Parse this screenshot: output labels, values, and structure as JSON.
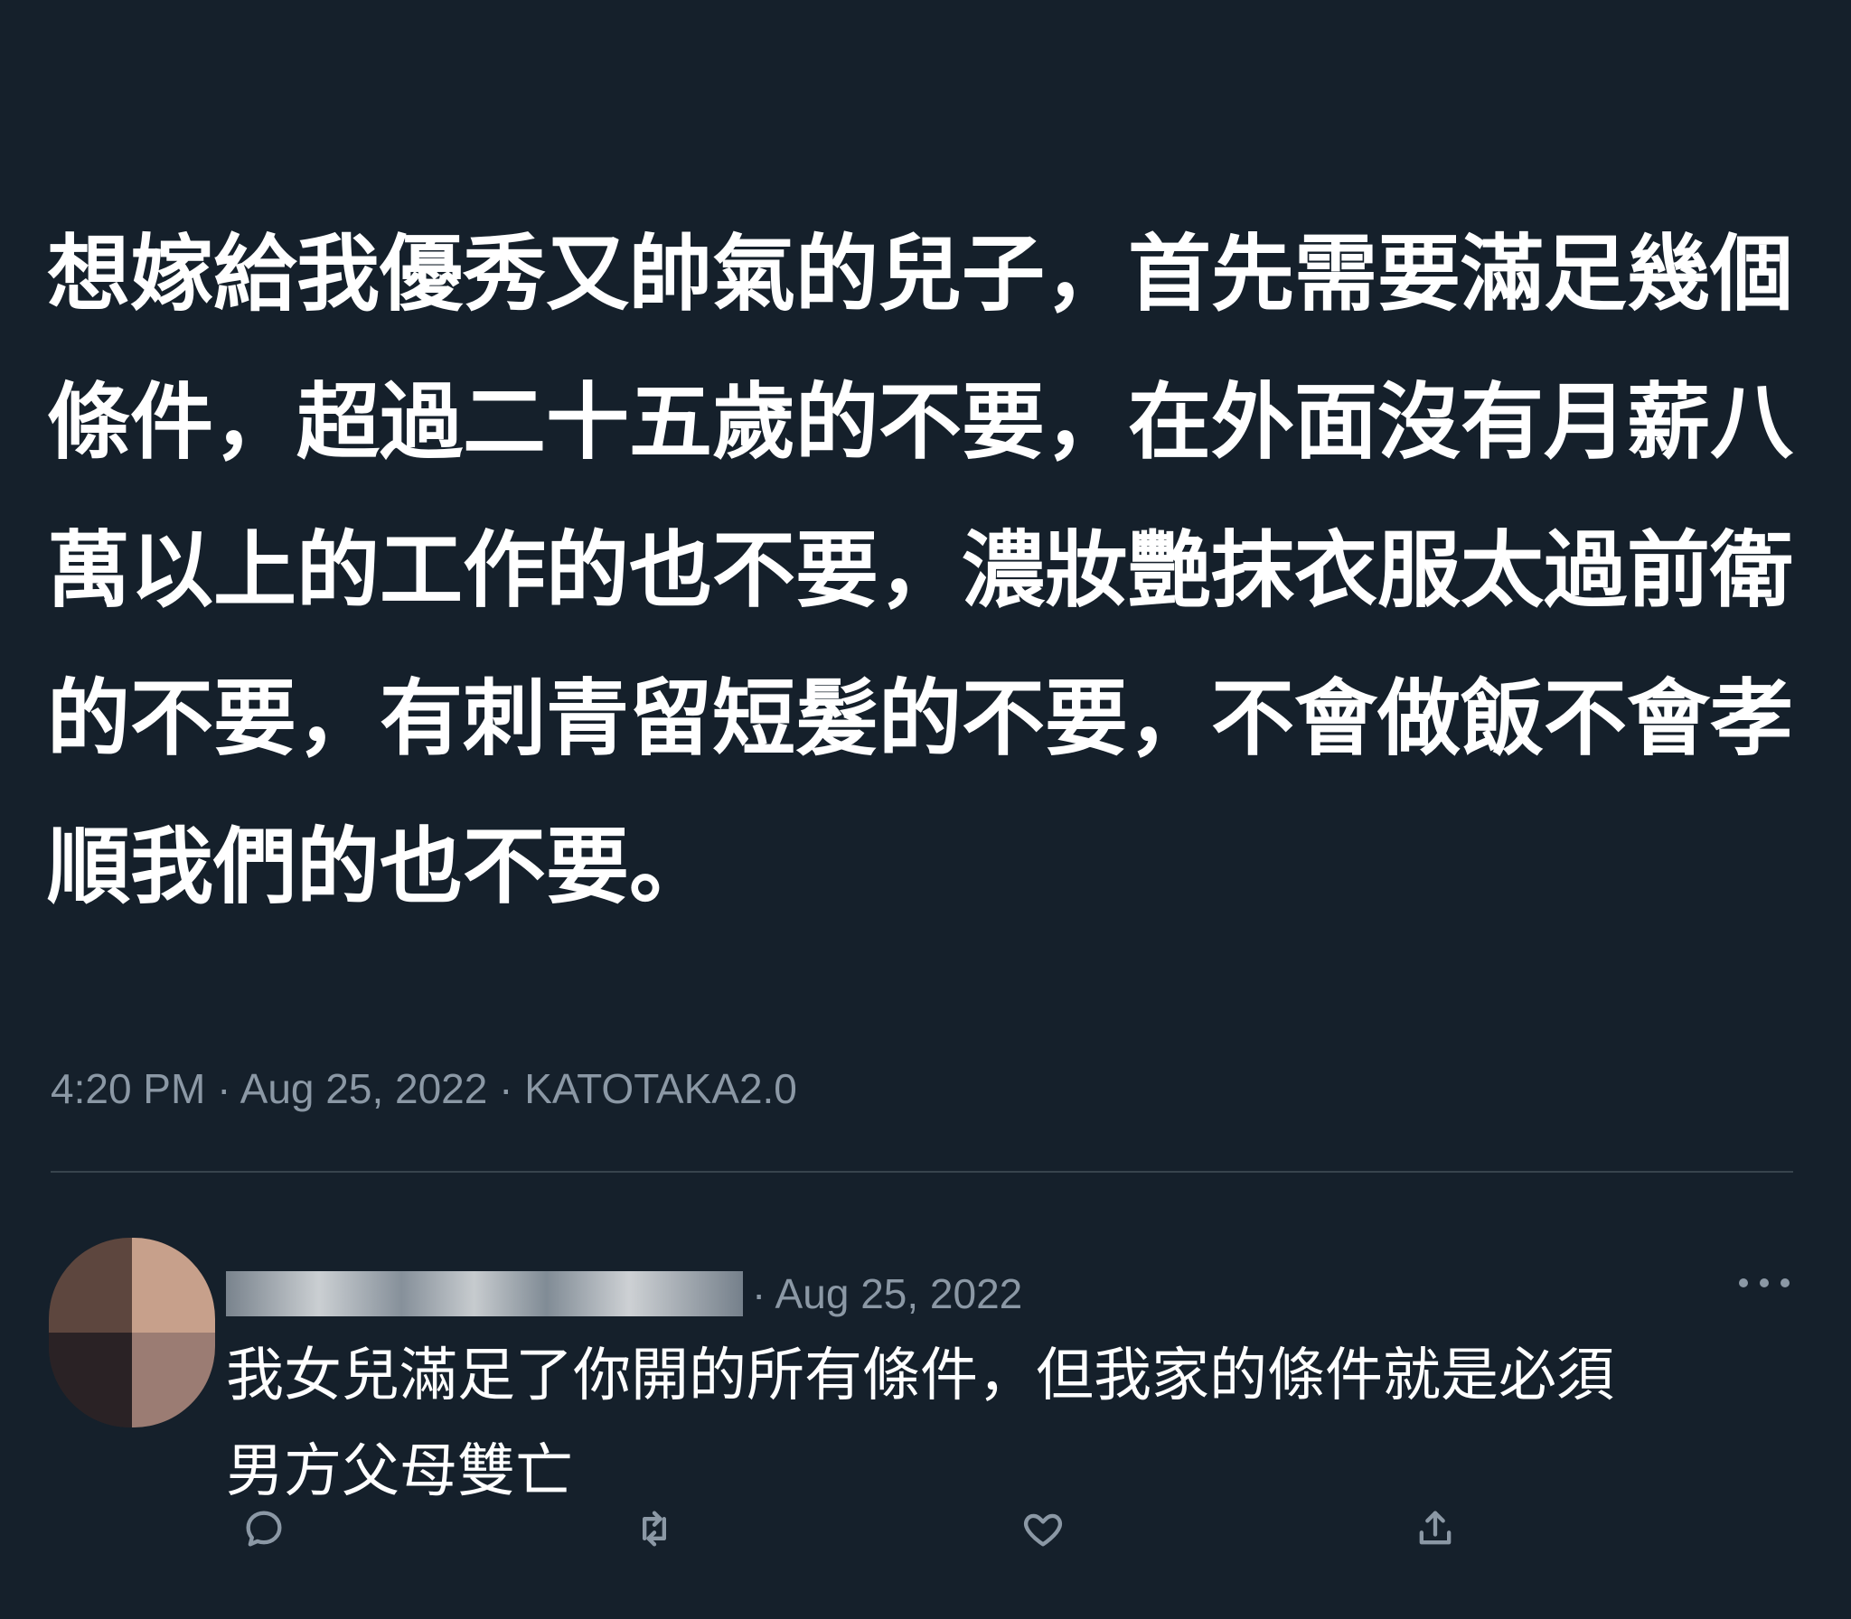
{
  "tweet": {
    "lines": [
      "想嫁給我優秀又帥氣的兒子，首先需要滿足幾個",
      "條件，超過二十五歲的不要，在外面沒有月薪八",
      "萬以上的工作的也不要，濃妝艷抹衣服太過前衛",
      "的不要，有刺青留短髮的不要，不會做飯不會孝",
      "順我們的也不要。"
    ],
    "meta": "4:20 PM · Aug 25, 2022 · KATOTAKA2.0"
  },
  "reply": {
    "date": "· Aug 25, 2022",
    "lines": [
      "我女兒滿足了你開的所有條件，但我家的條件就是必須",
      "男方父母雙亡"
    ]
  },
  "icons": {
    "more": "more-icon",
    "reply": "reply-icon",
    "retweet": "retweet-icon",
    "like": "heart-icon",
    "share": "share-icon"
  },
  "colors": {
    "background": "#15202b",
    "text": "#ffffff",
    "secondary": "#8b98a5",
    "divider": "#38444d"
  }
}
